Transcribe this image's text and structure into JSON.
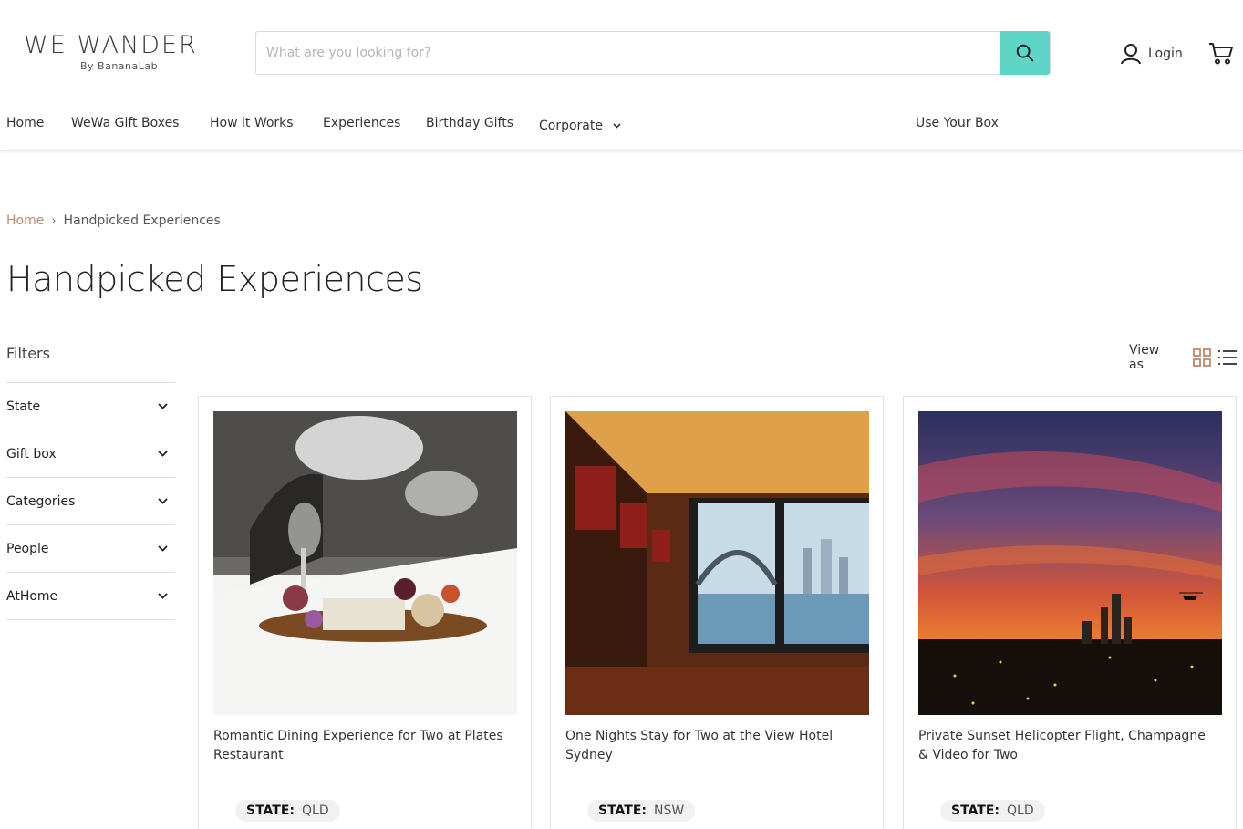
{
  "brand": {
    "name": "WE WANDER",
    "sub": "By BananaLab"
  },
  "search": {
    "placeholder": "What are you looking for?"
  },
  "account": {
    "login_label": "Login"
  },
  "nav": {
    "items": [
      "Home",
      "WeWa Gift Boxes",
      "How it Works",
      "Experiences",
      "Birthday Gifts",
      "Corporate"
    ],
    "use_box": "Use Your Box"
  },
  "breadcrumb": {
    "home": "Home",
    "separator": "›",
    "current": "Handpicked Experiences"
  },
  "page": {
    "title": "Handpicked Experiences"
  },
  "filters": {
    "title": "Filters",
    "items": [
      "State",
      "Gift box",
      "Categories",
      "People",
      "AtHome"
    ]
  },
  "view": {
    "label": "View as"
  },
  "products": [
    {
      "title": "Romantic Dining Experience for Two at Plates Restaurant",
      "state_label": "STATE:",
      "state_value": "QLD"
    },
    {
      "title": "One Nights Stay for Two at the View Hotel Sydney",
      "state_label": "STATE:",
      "state_value": "NSW"
    },
    {
      "title": "Private Sunset Helicopter Flight, Champagne & Video for Two",
      "state_label": "STATE:",
      "state_value": "QLD"
    }
  ],
  "colors": {
    "accent": "#5fd5c7",
    "breadcrumb_link": "#c0876b",
    "view_grid_icon": "#c0876b"
  }
}
